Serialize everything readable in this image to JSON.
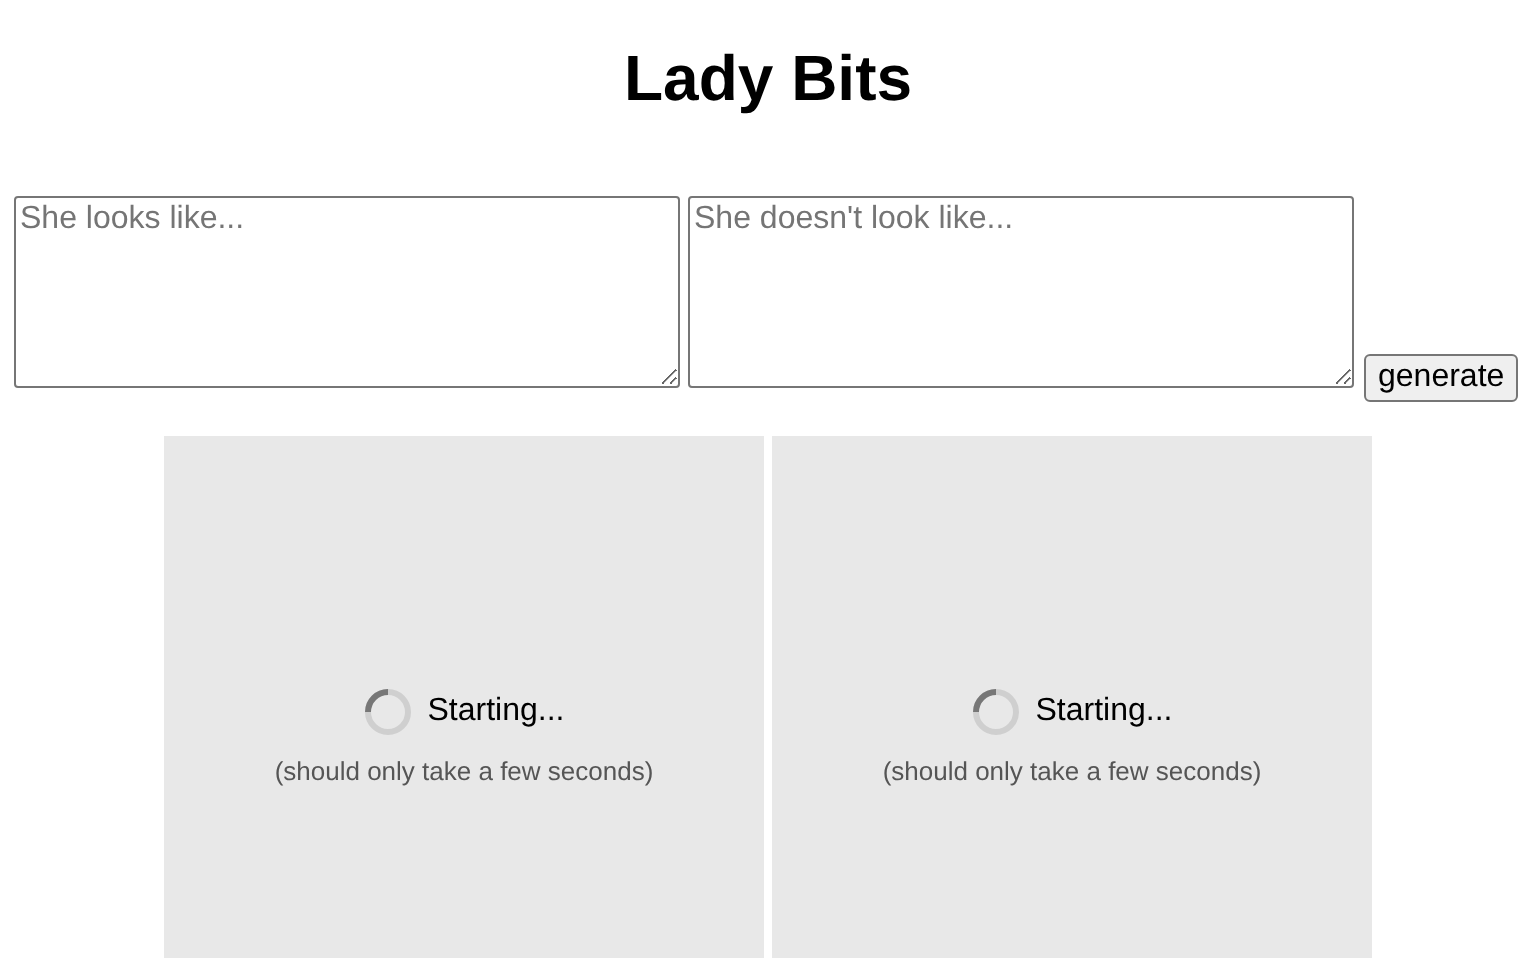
{
  "title": "Lady Bits",
  "prompts": [
    {
      "placeholder": "She looks like..."
    },
    {
      "placeholder": "She doesn't look like..."
    }
  ],
  "generate_button": {
    "label": "generate"
  },
  "panels": [
    {
      "status": "Starting...",
      "note": "(should only take a few seconds)"
    },
    {
      "status": "Starting...",
      "note": "(should only take a few seconds)"
    }
  ]
}
